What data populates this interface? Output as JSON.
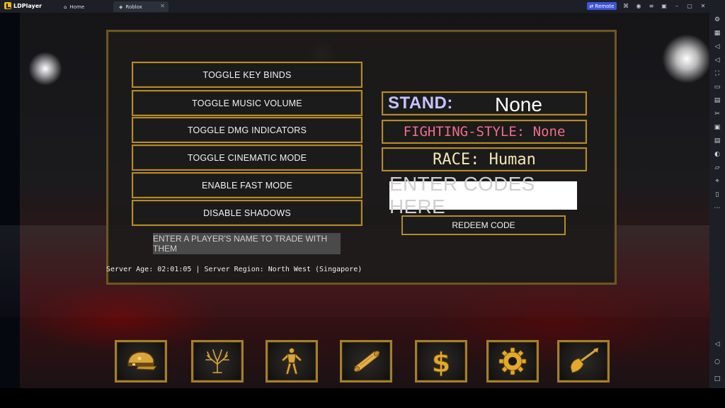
{
  "emulator": {
    "app_name": "LDPlayer",
    "tabs": [
      {
        "label": "Home",
        "icon": "home-icon"
      },
      {
        "label": "Roblox",
        "icon": "roblox-icon"
      }
    ],
    "remote_label": "Remote",
    "accent_color": "#3f53d9"
  },
  "settings": {
    "buttons": [
      "TOGGLE KEY BINDS",
      "TOGGLE MUSIC VOLUME",
      "TOGGLE DMG INDICATORS",
      "TOGGLE CINEMATIC MODE",
      "ENABLE FAST MODE",
      "DISABLE SHADOWS"
    ],
    "trade_placeholder": "ENTER A PLAYER'S NAME TO TRADE WITH THEM",
    "server_info": "Server Age: 02:01:05 | Server Region: North West (Singapore)"
  },
  "stats": {
    "stand_label": "STAND:",
    "stand_value": "None",
    "fighting_style": "FIGHTING-STYLE: None",
    "race": "RACE: Human"
  },
  "codes": {
    "placeholder": "ENTER CODES HERE",
    "redeem_label": "REDEEM CODE"
  },
  "hotbar": [
    {
      "icon": "cap-icon"
    },
    {
      "icon": "tree-icon"
    },
    {
      "icon": "stand-figure-icon"
    },
    {
      "icon": "scroll-icon"
    },
    {
      "icon": "dollar-icon"
    },
    {
      "icon": "gear-icon"
    },
    {
      "icon": "shovel-icon"
    }
  ],
  "colors": {
    "gold_border": "#b28a2e",
    "stand_label": "#c7c2ff",
    "fighting_style": "#f06d86",
    "race": "#f3e6b5"
  }
}
